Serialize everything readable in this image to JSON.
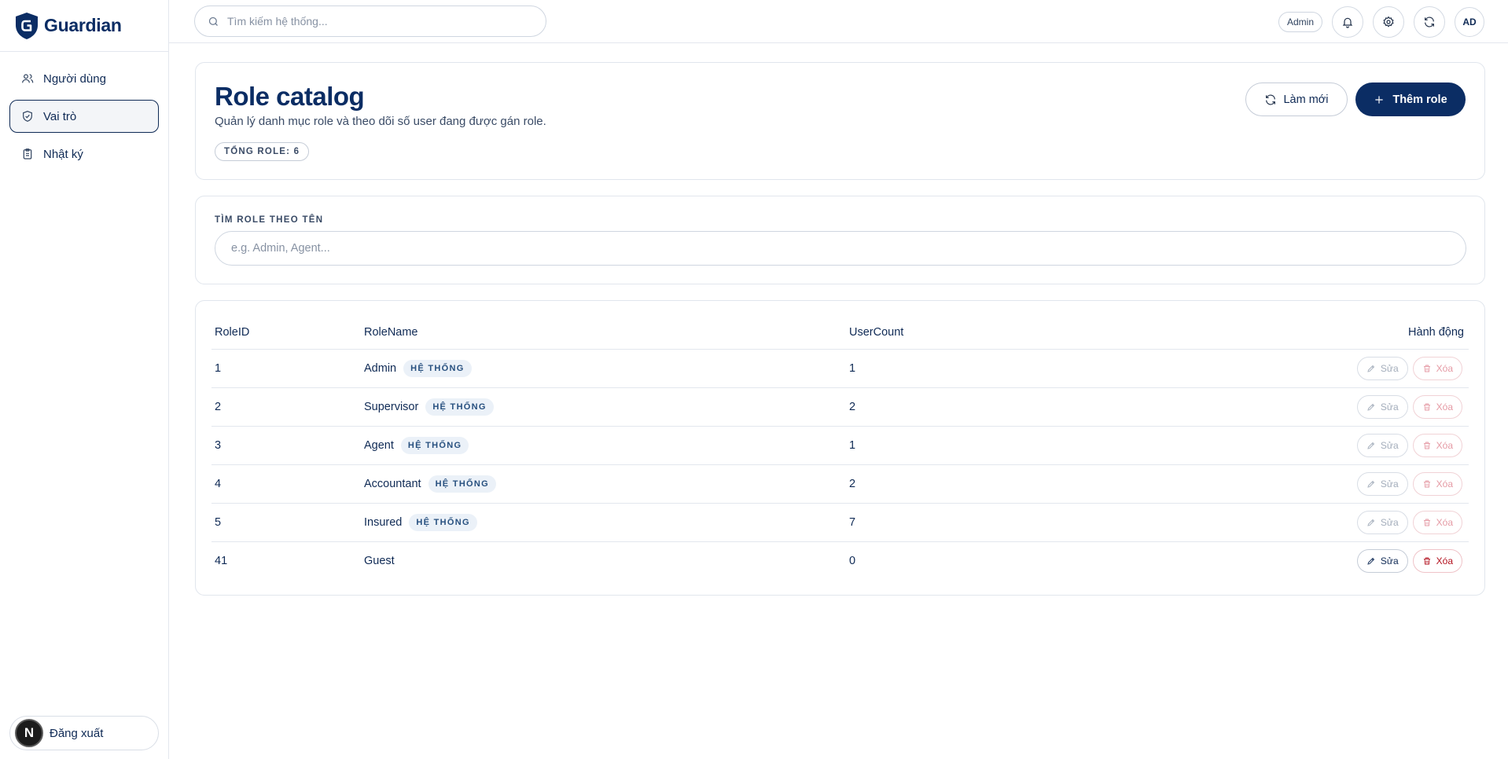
{
  "app": {
    "brand": "Guardian"
  },
  "sidebar": {
    "items": [
      {
        "label": "Người dùng",
        "icon": "users-icon",
        "active": false
      },
      {
        "label": "Vai trò",
        "icon": "shield-icon",
        "active": true
      },
      {
        "label": "Nhật ký",
        "icon": "clipboard-icon",
        "active": false
      }
    ],
    "logout_label": "Đăng xuất",
    "logout_badge": "N"
  },
  "topbar": {
    "search_placeholder": "Tìm kiếm hệ thống...",
    "role_label": "Admin",
    "avatar_initials": "AD",
    "icons": [
      "bell-icon",
      "gear-icon",
      "refresh-icon"
    ]
  },
  "header": {
    "title": "Role catalog",
    "subtitle": "Quản lý danh mục role và theo dõi số user đang được gán role.",
    "total_label": "TỔNG ROLE: 6",
    "refresh_label": "Làm mới",
    "add_label": "Thêm role"
  },
  "filter": {
    "label": "TÌM ROLE THEO TÊN",
    "placeholder": "e.g. Admin, Agent..."
  },
  "table": {
    "columns": [
      "RoleID",
      "RoleName",
      "UserCount",
      "Hành động"
    ],
    "system_tag": "HỆ THỐNG",
    "edit_label": "Sửa",
    "delete_label": "Xóa",
    "rows": [
      {
        "id": "1",
        "name": "Admin",
        "system": true,
        "count": "1"
      },
      {
        "id": "2",
        "name": "Supervisor",
        "system": true,
        "count": "2"
      },
      {
        "id": "3",
        "name": "Agent",
        "system": true,
        "count": "1"
      },
      {
        "id": "4",
        "name": "Accountant",
        "system": true,
        "count": "2"
      },
      {
        "id": "5",
        "name": "Insured",
        "system": true,
        "count": "7"
      },
      {
        "id": "41",
        "name": "Guest",
        "system": false,
        "count": "0"
      }
    ]
  },
  "colors": {
    "primary": "#0b2d64",
    "tag_bg": "#ebf1f8",
    "danger": "#b3121f"
  }
}
